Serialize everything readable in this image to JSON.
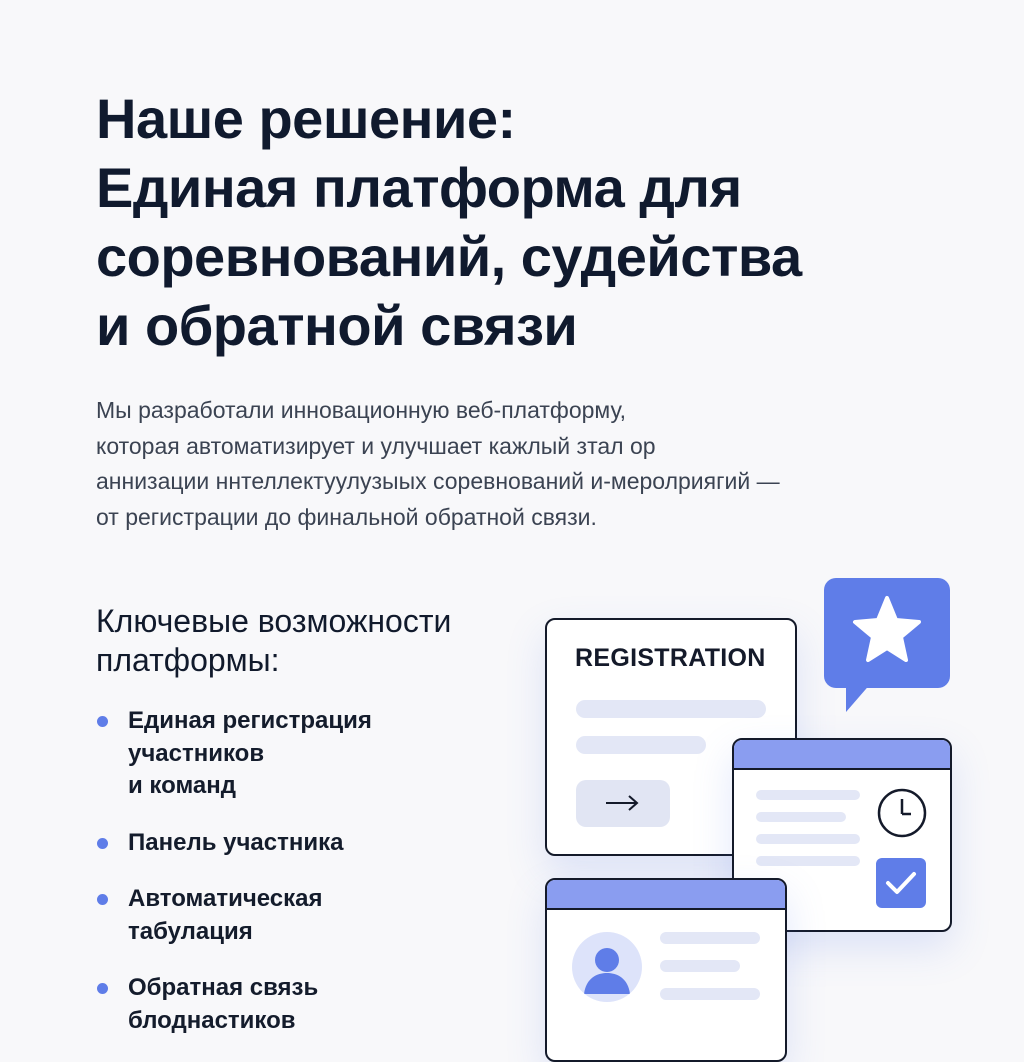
{
  "heading": {
    "lines": [
      "Наше решение:",
      "Единая платформа для",
      "соревнований, судейства",
      "и обратной связи"
    ]
  },
  "description": {
    "lines": [
      "Мы разработали инновационную веб-платформу,",
      "которая автоматизирует и улучшает кажлый зтал ор",
      "аннизации ннтеллектуулузыых соревнований и-меролриягий —",
      "от регистрации до финальной обратной связи."
    ]
  },
  "features": {
    "title_lines": [
      "Ключевые возможности",
      "платформы:"
    ],
    "items": [
      {
        "lines": [
          "Единая регистрация",
          "участников",
          "и команд"
        ]
      },
      {
        "lines": [
          "Панель участника"
        ]
      },
      {
        "lines": [
          "Автоматическая",
          "табулация"
        ]
      },
      {
        "lines": [
          "Обратная связь",
          "блоднастиков"
        ]
      }
    ]
  },
  "illustration": {
    "registration_card_title": "REGISTRATION",
    "icons": [
      "arrow-right-icon",
      "star-icon",
      "clock-icon",
      "checkmark-icon",
      "user-avatar-icon"
    ],
    "colors": {
      "accent": "#5f7de8",
      "header_fill": "#8a9df0",
      "placeholder_bar": "#e3e7f6",
      "outline": "#141a2a"
    }
  }
}
